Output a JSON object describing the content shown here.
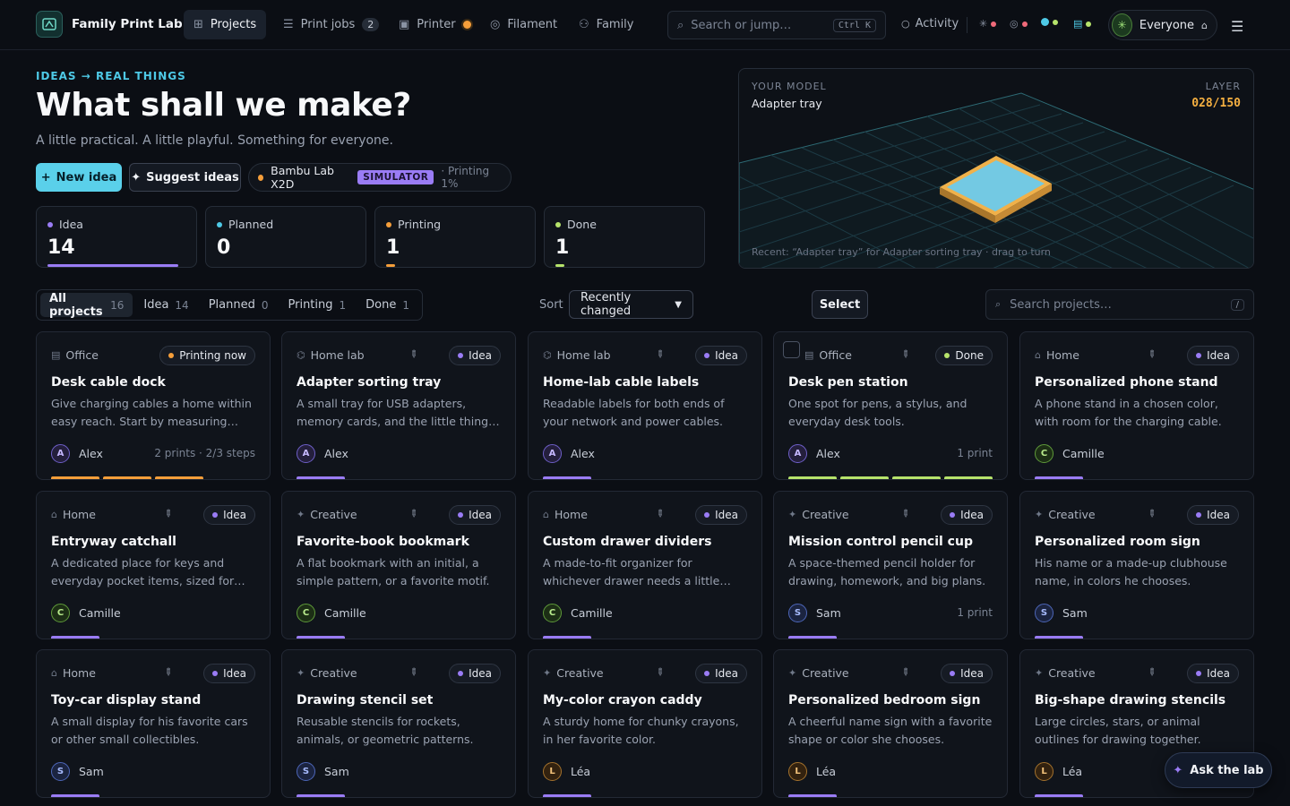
{
  "app": {
    "title": "Family Print Lab"
  },
  "nav": {
    "projects": "Projects",
    "print_jobs": "Print jobs",
    "print_jobs_count": "2",
    "printer": "Printer",
    "filament": "Filament",
    "family": "Family"
  },
  "search": {
    "placeholder": "Search or jump…",
    "shortcut": "Ctrl K"
  },
  "activity_label": "Activity",
  "profile": {
    "label": "Everyone"
  },
  "hero": {
    "eyebrow": "IDEAS → REAL THINGS",
    "title": "What shall we make?",
    "subtitle": "A little practical. A little playful. Something for everyone."
  },
  "actions": {
    "new_idea": "New idea",
    "suggest": "Suggest ideas"
  },
  "printer": {
    "name": "Bambu Lab X2D",
    "mode": "SIMULATOR",
    "status": "· Printing 1%"
  },
  "stats": [
    {
      "label": "Idea",
      "value": "14",
      "color": "#9a7cf5"
    },
    {
      "label": "Planned",
      "value": "0",
      "color": "#4ec9e6"
    },
    {
      "label": "Printing",
      "value": "1",
      "color": "#f59e3a"
    },
    {
      "label": "Done",
      "value": "1",
      "color": "#b6e36b"
    }
  ],
  "preview": {
    "label": "YOUR MODEL",
    "model": "Adapter tray",
    "layer_label": "LAYER",
    "layer": "028/150",
    "recent": "Recent: “Adapter tray” for Adapter sorting tray · drag to turn"
  },
  "filters": {
    "tabs": [
      {
        "label": "All projects",
        "count": "16"
      },
      {
        "label": "Idea",
        "count": "14"
      },
      {
        "label": "Planned",
        "count": "0"
      },
      {
        "label": "Printing",
        "count": "1"
      },
      {
        "label": "Done",
        "count": "1"
      }
    ],
    "sort_label": "Sort",
    "sort_value": "Recently changed",
    "select_label": "Select",
    "search_placeholder": "Search projects…",
    "search_shortcut": "/"
  },
  "projects": [
    {
      "category": "Office",
      "status": "Printing now",
      "title": "Desk cable dock",
      "desc": "Give charging cables a home within easy reach. Start by measuring the…",
      "owner": "Alex",
      "initial": "A",
      "meta": "2 prints · 2/3 steps"
    },
    {
      "category": "Home lab",
      "status": "Idea",
      "title": "Adapter sorting tray",
      "desc": "A small tray for USB adapters, memory cards, and the little things that…",
      "owner": "Alex",
      "initial": "A",
      "meta": ""
    },
    {
      "category": "Home lab",
      "status": "Idea",
      "title": "Home-lab cable labels",
      "desc": "Readable labels for both ends of your network and power cables.",
      "owner": "Alex",
      "initial": "A",
      "meta": ""
    },
    {
      "category": "Office",
      "status": "Done",
      "title": "Desk pen station",
      "desc": "One spot for pens, a stylus, and everyday desk tools.",
      "owner": "Alex",
      "initial": "A",
      "meta": "1 print"
    },
    {
      "category": "Home",
      "status": "Idea",
      "title": "Personalized phone stand",
      "desc": "A phone stand in a chosen color, with room for the charging cable.",
      "owner": "Camille",
      "initial": "C",
      "meta": ""
    },
    {
      "category": "Home",
      "status": "Idea",
      "title": "Entryway catchall",
      "desc": "A dedicated place for keys and everyday pocket items, sized for your…",
      "owner": "Camille",
      "initial": "C",
      "meta": ""
    },
    {
      "category": "Creative",
      "status": "Idea",
      "title": "Favorite-book bookmark",
      "desc": "A flat bookmark with an initial, a simple pattern, or a favorite motif.",
      "owner": "Camille",
      "initial": "C",
      "meta": ""
    },
    {
      "category": "Home",
      "status": "Idea",
      "title": "Custom drawer dividers",
      "desc": "A made-to-fit organizer for whichever drawer needs a little order.",
      "owner": "Camille",
      "initial": "C",
      "meta": ""
    },
    {
      "category": "Creative",
      "status": "Idea",
      "title": "Mission control pencil cup",
      "desc": "A space-themed pencil holder for drawing, homework, and big plans.",
      "owner": "Sam",
      "initial": "S",
      "meta": "1 print"
    },
    {
      "category": "Creative",
      "status": "Idea",
      "title": "Personalized room sign",
      "desc": "His name or a made-up clubhouse name, in colors he chooses.",
      "owner": "Sam",
      "initial": "S",
      "meta": ""
    },
    {
      "category": "Home",
      "status": "Idea",
      "title": "Toy-car display stand",
      "desc": "A small display for his favorite cars or other small collectibles.",
      "owner": "Sam",
      "initial": "S",
      "meta": ""
    },
    {
      "category": "Creative",
      "status": "Idea",
      "title": "Drawing stencil set",
      "desc": "Reusable stencils for rockets, animals, or geometric patterns.",
      "owner": "Sam",
      "initial": "S",
      "meta": ""
    },
    {
      "category": "Creative",
      "status": "Idea",
      "title": "My-color crayon caddy",
      "desc": "A sturdy home for chunky crayons, in her favorite color.",
      "owner": "Léa",
      "initial": "L",
      "meta": ""
    },
    {
      "category": "Creative",
      "status": "Idea",
      "title": "Personalized bedroom sign",
      "desc": "A cheerful name sign with a favorite shape or color she chooses.",
      "owner": "Léa",
      "initial": "L",
      "meta": ""
    },
    {
      "category": "Creative",
      "status": "Idea",
      "title": "Big-shape drawing stencils",
      "desc": "Large circles, stars, or animal outlines for drawing together.",
      "owner": "Léa",
      "initial": "L",
      "meta": ""
    }
  ],
  "ask_label": "Ask the lab"
}
